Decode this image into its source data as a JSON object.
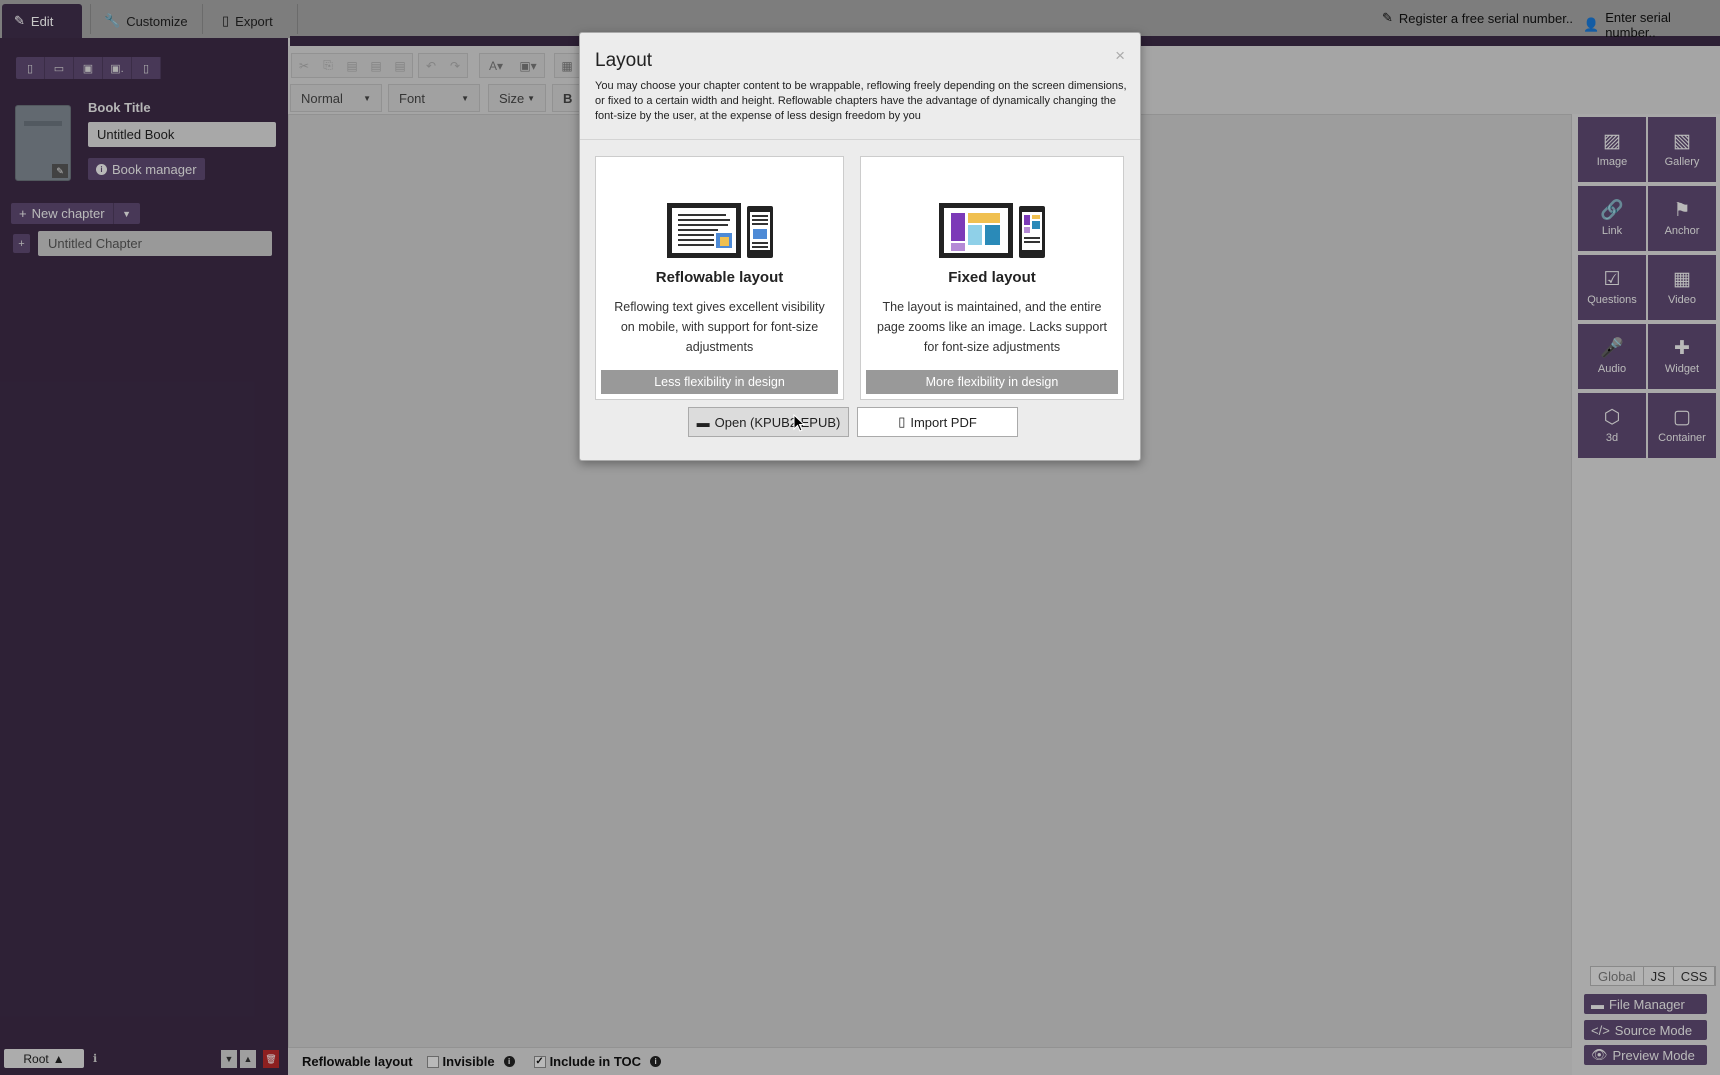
{
  "topbar": {
    "tabs": [
      {
        "label": "Edit",
        "icon": "pencil-icon"
      },
      {
        "label": "Customize",
        "icon": "wrench-icon"
      },
      {
        "label": "Export",
        "icon": "tablet-icon"
      }
    ],
    "register_label": "Register a free serial number..",
    "serial_label": "Enter serial number.."
  },
  "sidebar": {
    "book_title_label": "Book Title",
    "book_title_value": "Untitled Book",
    "book_manager_label": "Book manager",
    "new_chapter_label": "New chapter",
    "chapters": [
      {
        "label": "Untitled Chapter"
      }
    ],
    "root_label": "Root"
  },
  "toolbar": {
    "paragraph_style": "Normal",
    "font": "Font",
    "size": "Size",
    "bold": "B"
  },
  "widgets": [
    {
      "label": "Image",
      "icon": "image-icon"
    },
    {
      "label": "Gallery",
      "icon": "gallery-icon"
    },
    {
      "label": "Link",
      "icon": "link-icon"
    },
    {
      "label": "Anchor",
      "icon": "flag-icon"
    },
    {
      "label": "Questions",
      "icon": "checkbox-icon"
    },
    {
      "label": "Video",
      "icon": "film-icon"
    },
    {
      "label": "Audio",
      "icon": "microphone-icon"
    },
    {
      "label": "Widget",
      "icon": "puzzle-icon"
    },
    {
      "label": "3d",
      "icon": "cube-icon"
    },
    {
      "label": "Container",
      "icon": "square-icon"
    }
  ],
  "right_bottom": {
    "seg": [
      "Global",
      "JS",
      "CSS"
    ],
    "file_manager": "File Manager",
    "source_mode": "Source Mode",
    "preview_mode": "Preview Mode"
  },
  "statusbar": {
    "layout": "Reflowable layout",
    "invisible": "Invisible",
    "include_toc": "Include in TOC"
  },
  "modal": {
    "title": "Layout",
    "close": "×",
    "description": "You may choose your chapter content to be wrappable, reflowing freely depending on the screen dimensions, or fixed to a certain width and height. Reflowable chapters have the advantage of dynamically changing the font-size by the user, at the expense of less design freedom by you",
    "reflowable": {
      "title": "Reflowable layout",
      "text": "Reflowing text gives excellent visibility on mobile, with support for font-size adjustments",
      "button": "Less flexibility in design"
    },
    "fixed": {
      "title": "Fixed layout",
      "text": "The layout is maintained, and the entire page zooms like an image. Lacks support for font-size adjustments",
      "button": "More flexibility in design"
    },
    "open_button": "Open (KPUB2,EPUB)",
    "import_button": "Import PDF"
  },
  "colors": {
    "sidebar": "#3b2a45",
    "accent": "#5d4870",
    "topbar": "#a0a0a0"
  }
}
